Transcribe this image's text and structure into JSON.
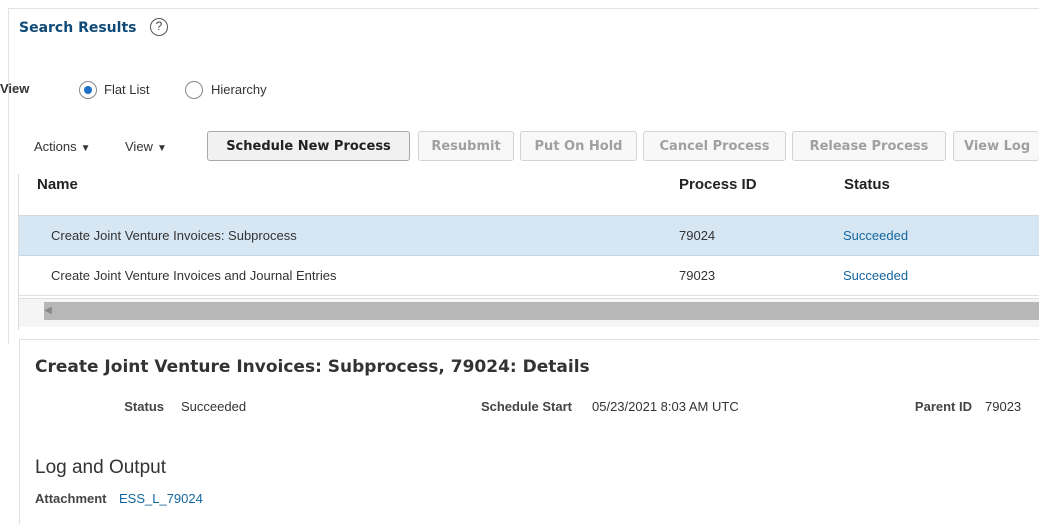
{
  "search_results": {
    "title": "Search Results",
    "help_glyph": "?"
  },
  "view_toggle": {
    "label": "View",
    "options": [
      {
        "label": "Flat List",
        "selected": true
      },
      {
        "label": "Hierarchy",
        "selected": false
      }
    ]
  },
  "toolbar": {
    "actions_label": "Actions",
    "view_label": "View",
    "menu_arrow": "▼",
    "buttons": {
      "schedule_new_process": "Schedule New Process",
      "resubmit": "Resubmit",
      "put_on_hold": "Put On Hold",
      "cancel_process": "Cancel Process",
      "release_process": "Release Process",
      "view_log": "View Log"
    }
  },
  "table": {
    "columns": {
      "name": "Name",
      "process_id": "Process ID",
      "status": "Status"
    },
    "rows": [
      {
        "name": "Create Joint Venture Invoices: Subprocess",
        "process_id": "79024",
        "status": "Succeeded",
        "selected": true
      },
      {
        "name": "Create Joint Venture Invoices and Journal Entries",
        "process_id": "79023",
        "status": "Succeeded",
        "selected": false
      }
    ],
    "scroll_left_glyph": "◀"
  },
  "details": {
    "title": "Create Joint Venture Invoices: Subprocess, 79024: Details",
    "status_label": "Status",
    "status_value": "Succeeded",
    "schedule_start_label": "Schedule Start",
    "schedule_start_value": "05/23/2021 8:03 AM UTC",
    "parent_id_label": "Parent ID",
    "parent_id_value": "79023",
    "log_title": "Log and Output",
    "attachment_label": "Attachment",
    "attachment_value": "ESS_L_79024"
  },
  "colors": {
    "accent": "#14669e",
    "selected_row": "#d6e6f3",
    "title_blue": "#0f4a78"
  }
}
